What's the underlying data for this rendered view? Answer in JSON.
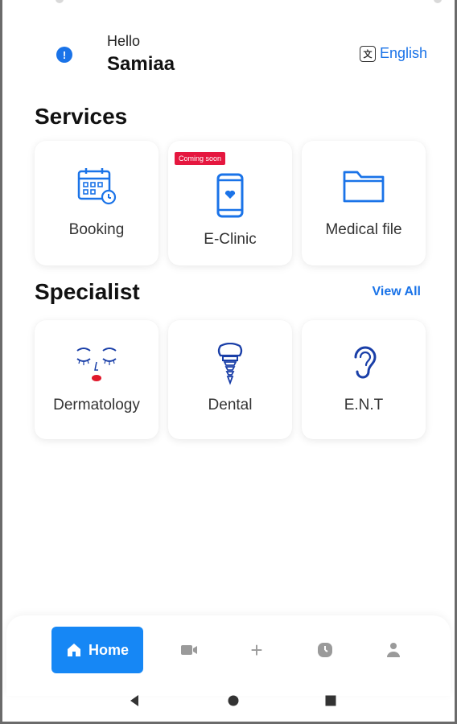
{
  "header": {
    "greeting": "Hello",
    "username": "Samiaa",
    "language_label": "English",
    "language_icon": "translate-icon",
    "alert_icon": "alert-icon"
  },
  "services": {
    "title": "Services",
    "items": [
      {
        "label": "Booking",
        "icon": "calendar-clock-icon"
      },
      {
        "label": "E-Clinic",
        "icon": "phone-heart-icon",
        "badge": "Coming soon"
      },
      {
        "label": "Medical file",
        "icon": "folder-icon"
      }
    ]
  },
  "specialist": {
    "title": "Specialist",
    "view_all": "View All",
    "items": [
      {
        "label": "Dermatology",
        "icon": "face-icon"
      },
      {
        "label": "Dental",
        "icon": "tooth-implant-icon"
      },
      {
        "label": "E.N.T",
        "icon": "ear-icon"
      }
    ]
  },
  "bottom_nav": {
    "home_label": "Home",
    "items": [
      "home-icon",
      "video-icon",
      "plus-icon",
      "clock-icon",
      "profile-icon"
    ]
  },
  "colors": {
    "accent": "#1a73e8",
    "home_button": "#1687f5",
    "badge": "#e5173f"
  }
}
